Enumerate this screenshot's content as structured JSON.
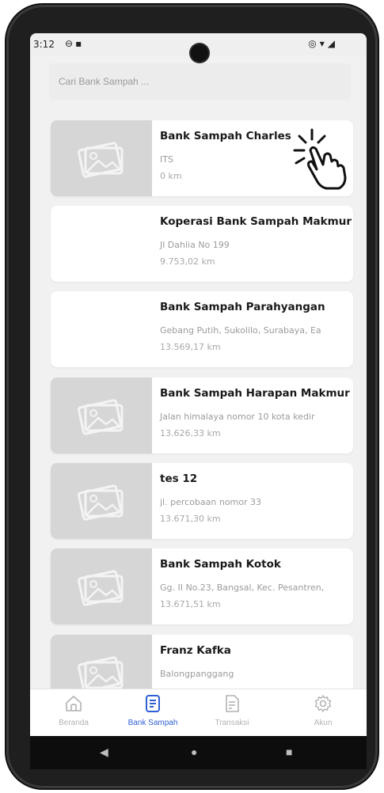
{
  "status_bar": {
    "time": "3:12",
    "left_icons": [
      "data-saver-icon",
      "sd-card-icon"
    ],
    "right_icons": [
      "location-icon",
      "wifi-icon",
      "signal-icon"
    ]
  },
  "search": {
    "placeholder": "Cari Bank Sampah ..."
  },
  "banks": [
    {
      "name": "Bank Sampah Charles",
      "address": "ITS",
      "distance": "0 km",
      "has_image": true
    },
    {
      "name": "Koperasi Bank Sampah Makmur",
      "address": "Jl Dahlia No 199",
      "distance": "9.753,02 km",
      "has_image": false
    },
    {
      "name": "Bank Sampah Parahyangan",
      "address": "Gebang Putih, Sukolilo, Surabaya, Ea",
      "distance": "13.569,17 km",
      "has_image": false
    },
    {
      "name": "Bank Sampah Harapan Makmur",
      "address": "Jalan himalaya nomor 10 kota kedir",
      "distance": "13.626,33 km",
      "has_image": true
    },
    {
      "name": "tes 12",
      "address": "jl. percobaan nomor 33",
      "distance": "13.671,30 km",
      "has_image": true
    },
    {
      "name": "Bank Sampah Kotok",
      "address": "Gg. II No.23, Bangsal, Kec. Pesantren,",
      "distance": "13.671,51 km",
      "has_image": true
    },
    {
      "name": "Franz Kafka",
      "address": "Balongpanggang",
      "distance": "",
      "has_image": true
    }
  ],
  "bottom_nav": [
    {
      "label": "Beranda",
      "icon": "home-icon",
      "active": false
    },
    {
      "label": "Bank Sampah",
      "icon": "document-list-icon",
      "active": true
    },
    {
      "label": "Transaksi",
      "icon": "transaction-icon",
      "active": false
    },
    {
      "label": "Akun",
      "icon": "gear-icon",
      "active": false
    }
  ],
  "system_nav": {
    "icons": [
      "back-icon",
      "home-icon",
      "recents-icon"
    ]
  },
  "colors": {
    "accent": "#2f5fd6",
    "placeholder_image": "#d6d6d6",
    "inactive": "#b2b2b2"
  }
}
